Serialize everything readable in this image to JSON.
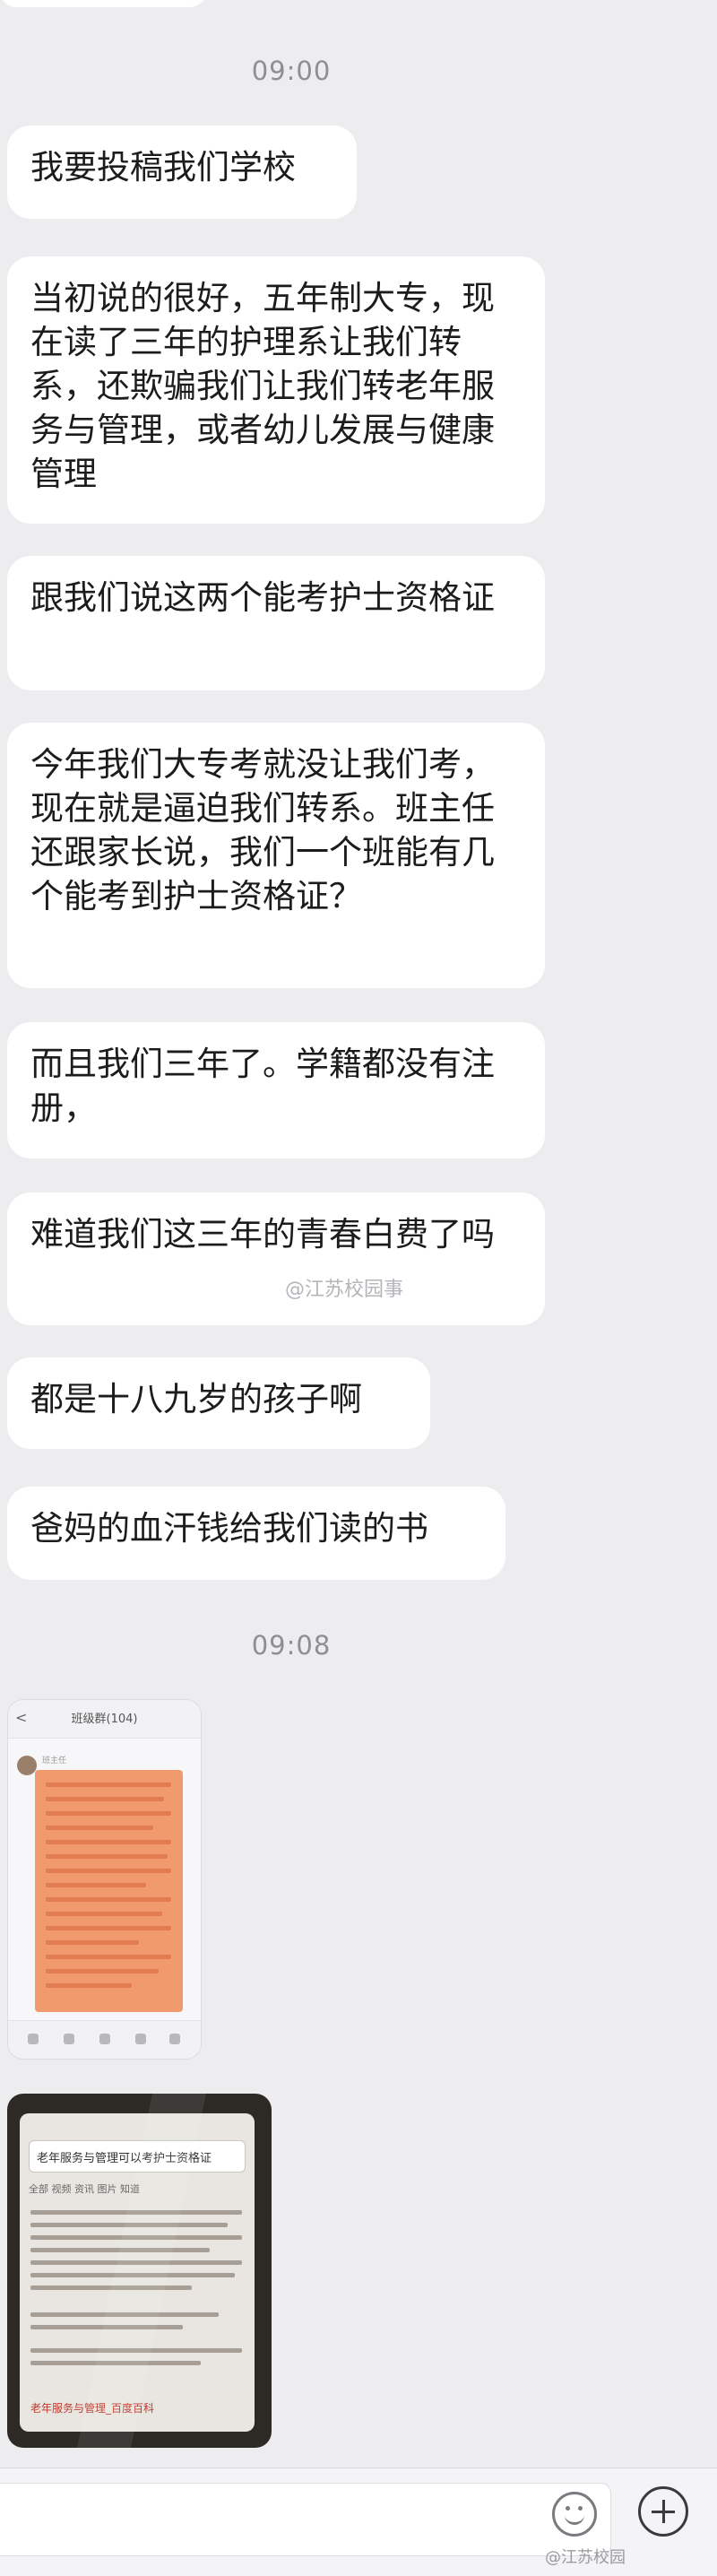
{
  "timestamps": [
    "09:00",
    "09:08"
  ],
  "messages": [
    "我要投稿我们学校",
    "当初说的很好，五年制大专，现在读了三年的护理系让我们转系，还欺骗我们让我们转老年服务与管理，或者幼儿发展与健康管理",
    "跟我们说这两个能考护士资格证",
    "今年我们大专考就没让我们考，现在就是逼迫我们转系。班主任还跟家长说，我们一个班能有几个能考到护士资格证？",
    "而且我们三年了。学籍都没有注册，",
    "难道我们这三年的青春白费了吗",
    "都是十八九岁的孩子啊",
    "爸妈的血汗钱给我们读的书"
  ],
  "image1": {
    "header_title": "班级群(104)",
    "sender": "班主任"
  },
  "image2": {
    "search_text": "老年服务与管理可以考护士资格证",
    "tabs": "全部   视频   资讯   图片   知道",
    "result_title": "老年服务与管理_百度百科"
  },
  "watermarks": {
    "middle": "@江苏校园事",
    "bottom": "@江苏校园"
  },
  "icons": {
    "emoji": "smiley-face-icon",
    "add": "plus-circle-icon"
  }
}
